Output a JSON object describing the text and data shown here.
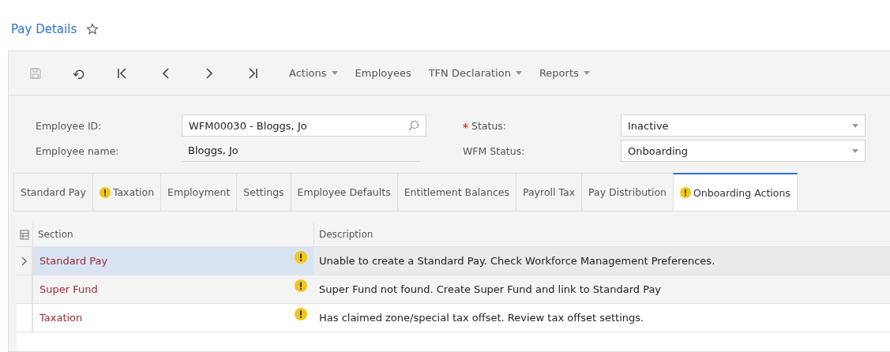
{
  "page": {
    "title": "Pay Details",
    "favorite": false
  },
  "toolbar": {
    "icon_buttons": [
      {
        "kind": "save",
        "disabled": true
      },
      {
        "kind": "undo",
        "disabled": false
      },
      {
        "kind": "first",
        "disabled": false
      },
      {
        "kind": "previous",
        "disabled": false
      },
      {
        "kind": "next",
        "disabled": false
      },
      {
        "kind": "last",
        "disabled": false
      }
    ],
    "menus": [
      {
        "label": "Actions",
        "dropdown": true
      },
      {
        "label": "Employees",
        "dropdown": false
      },
      {
        "label": "TFN Declaration",
        "dropdown": true
      },
      {
        "label": "Reports",
        "dropdown": true
      }
    ]
  },
  "form": {
    "left": [
      {
        "label": "Employee ID:",
        "kind": "lookup",
        "value": "WFM00030 - Bloggs, Jo",
        "required": false
      },
      {
        "label": "Employee name:",
        "kind": "readonly",
        "value": "Bloggs, Jo",
        "required": false
      }
    ],
    "right": [
      {
        "label": "Status:",
        "kind": "select",
        "value": "Inactive",
        "required": true
      },
      {
        "label": "WFM Status:",
        "kind": "select",
        "value": "Onboarding",
        "required": false
      }
    ]
  },
  "tabs": [
    {
      "label": "Standard Pay",
      "selected": false,
      "warning": false
    },
    {
      "label": "Taxation",
      "selected": false,
      "warning": true
    },
    {
      "label": "Employment",
      "selected": false,
      "warning": false
    },
    {
      "label": "Settings",
      "selected": false,
      "warning": false
    },
    {
      "label": "Employee Defaults",
      "selected": false,
      "warning": false
    },
    {
      "label": "Entitlement Balances",
      "selected": false,
      "warning": false
    },
    {
      "label": "Payroll Tax",
      "selected": false,
      "warning": false
    },
    {
      "label": "Pay Distribution",
      "selected": false,
      "warning": false
    },
    {
      "label": "Onboarding Actions",
      "selected": true,
      "warning": true
    }
  ],
  "table": {
    "columns": [
      "Section",
      "Description"
    ],
    "rows": [
      {
        "section": "Standard Pay",
        "warning": true,
        "description": "Unable to create a Standard Pay. Check Workforce Management Preferences.",
        "selected": true
      },
      {
        "section": "Super Fund",
        "warning": true,
        "description": "Super Fund not found. Create Super Fund and link to Standard Pay",
        "selected": false
      },
      {
        "section": "Taxation",
        "warning": true,
        "description": "Has claimed zone/special tax offset. Review tax offset settings.",
        "selected": false
      }
    ]
  }
}
